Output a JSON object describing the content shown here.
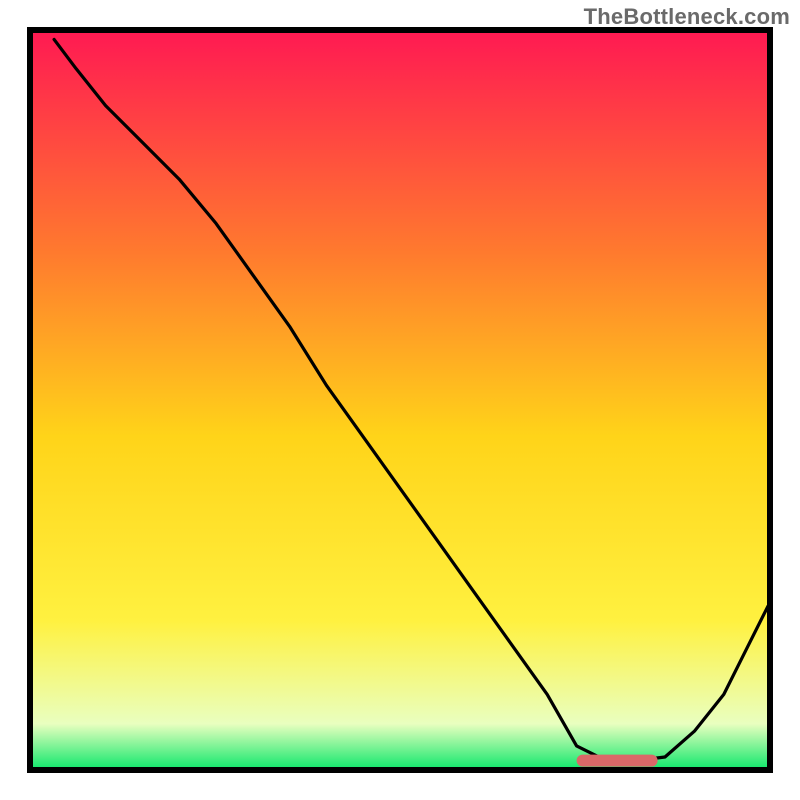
{
  "watermark": "TheBottleneck.com",
  "colors": {
    "frame": "#000000",
    "curve": "#000000",
    "marker": "#da6868",
    "grad_top": "#ff1a52",
    "grad_mid_upper": "#ff7a2e",
    "grad_mid": "#ffd419",
    "grad_mid_lower": "#fff140",
    "grad_bottom_a": "#e9ffbf",
    "grad_bottom": "#16e86e"
  },
  "chart_data": {
    "type": "line",
    "title": "",
    "xlabel": "",
    "ylabel": "",
    "xlim": [
      0,
      100
    ],
    "ylim": [
      0,
      100
    ],
    "marker_range_x": [
      74,
      85
    ],
    "x": [
      3,
      6,
      10,
      15,
      20,
      25,
      30,
      35,
      40,
      45,
      50,
      55,
      60,
      65,
      70,
      74,
      78,
      82,
      86,
      90,
      94,
      97,
      100
    ],
    "values": [
      99,
      95,
      90,
      85,
      80,
      74,
      67,
      60,
      52,
      45,
      38,
      31,
      24,
      17,
      10,
      3,
      1,
      1,
      1.5,
      5,
      10,
      16,
      22
    ]
  }
}
